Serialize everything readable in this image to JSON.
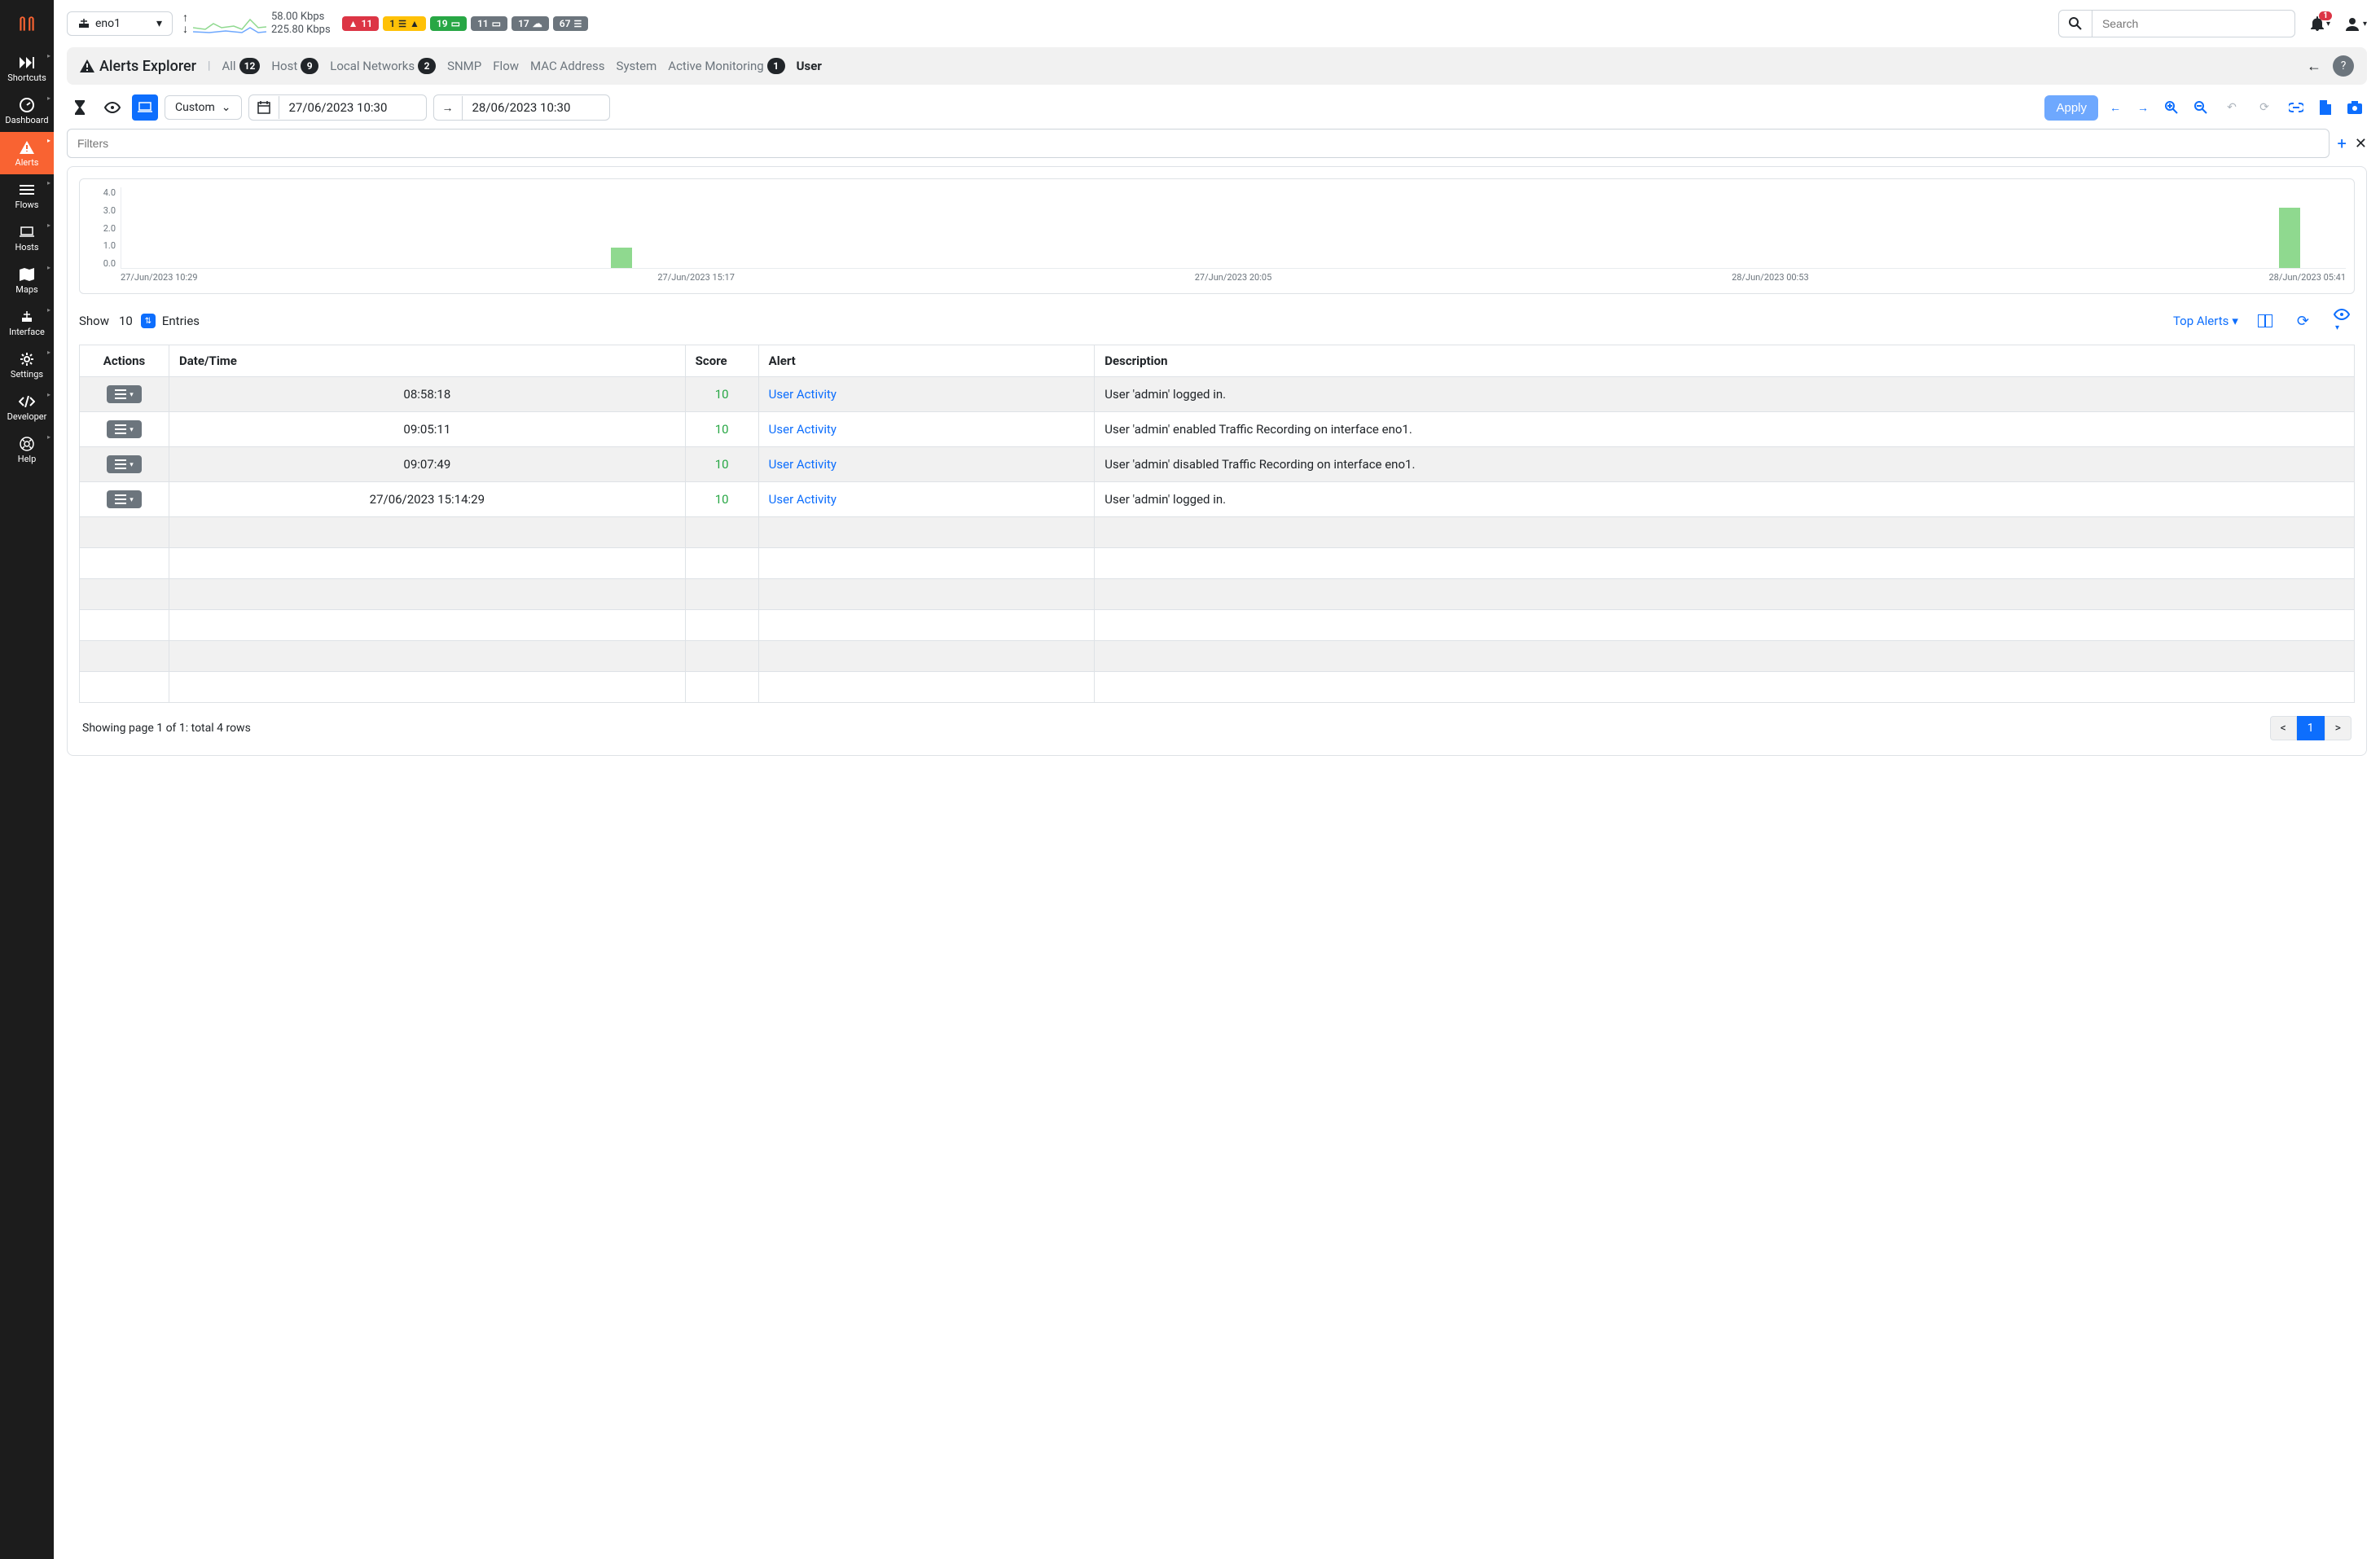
{
  "sidebar": {
    "items": [
      {
        "label": "Shortcuts"
      },
      {
        "label": "Dashboard"
      },
      {
        "label": "Alerts"
      },
      {
        "label": "Flows"
      },
      {
        "label": "Hosts"
      },
      {
        "label": "Maps"
      },
      {
        "label": "Interface"
      },
      {
        "label": "Settings"
      },
      {
        "label": "Developer"
      },
      {
        "label": "Help"
      }
    ]
  },
  "topbar": {
    "interface": "eno1",
    "traffic_up": "58.00 Kbps",
    "traffic_down": "225.80 Kbps",
    "badges": [
      {
        "value": "11",
        "color": "red"
      },
      {
        "value": "1",
        "color": "yellow"
      },
      {
        "value": "19",
        "color": "green"
      },
      {
        "value": "11",
        "color": "gray"
      },
      {
        "value": "17",
        "color": "gray"
      },
      {
        "value": "67",
        "color": "gray"
      }
    ],
    "search_placeholder": "Search",
    "bell_count": "1"
  },
  "navbar": {
    "title": "Alerts Explorer",
    "links": [
      {
        "label": "All",
        "badge": "12"
      },
      {
        "label": "Host",
        "badge": "9"
      },
      {
        "label": "Local Networks",
        "badge": "2"
      },
      {
        "label": "SNMP"
      },
      {
        "label": "Flow"
      },
      {
        "label": "MAC Address"
      },
      {
        "label": "System"
      },
      {
        "label": "Active Monitoring",
        "badge": "1"
      },
      {
        "label": "User",
        "active": true
      }
    ]
  },
  "toolbar": {
    "range_label": "Custom",
    "date_from": "27/06/2023 10:30",
    "date_to": "28/06/2023 10:30",
    "apply_label": "Apply"
  },
  "filters": {
    "placeholder": "Filters"
  },
  "chart_data": {
    "type": "bar",
    "y_ticks": [
      "4.0",
      "3.0",
      "2.0",
      "1.0",
      "0.0"
    ],
    "x_ticks": [
      "27/Jun/2023 10:29",
      "27/Jun/2023 15:17",
      "27/Jun/2023 20:05",
      "28/Jun/2023 00:53",
      "28/Jun/2023 05:41"
    ],
    "ylim": [
      0,
      4
    ],
    "bars": [
      {
        "position_pct": 22,
        "value": 1
      },
      {
        "position_pct": 97,
        "value": 3
      }
    ]
  },
  "table": {
    "show_label": "Show",
    "entries_label": "Entries",
    "entries_value": "10",
    "top_alerts_label": "Top Alerts",
    "columns": [
      "Actions",
      "Date/Time",
      "Score",
      "Alert",
      "Description"
    ],
    "rows": [
      {
        "datetime": "08:58:18",
        "score": "10",
        "alert": "User Activity",
        "description": "User 'admin' logged in."
      },
      {
        "datetime": "09:05:11",
        "score": "10",
        "alert": "User Activity",
        "description": "User 'admin' enabled Traffic Recording on interface eno1."
      },
      {
        "datetime": "09:07:49",
        "score": "10",
        "alert": "User Activity",
        "description": "User 'admin' disabled Traffic Recording on interface eno1."
      },
      {
        "datetime": "27/06/2023 15:14:29",
        "score": "10",
        "alert": "User Activity",
        "description": "User 'admin' logged in."
      }
    ],
    "empty_rows": 6,
    "footer_text": "Showing page 1 of 1: total 4 rows",
    "pagination": {
      "prev": "<",
      "current": "1",
      "next": ">"
    }
  }
}
